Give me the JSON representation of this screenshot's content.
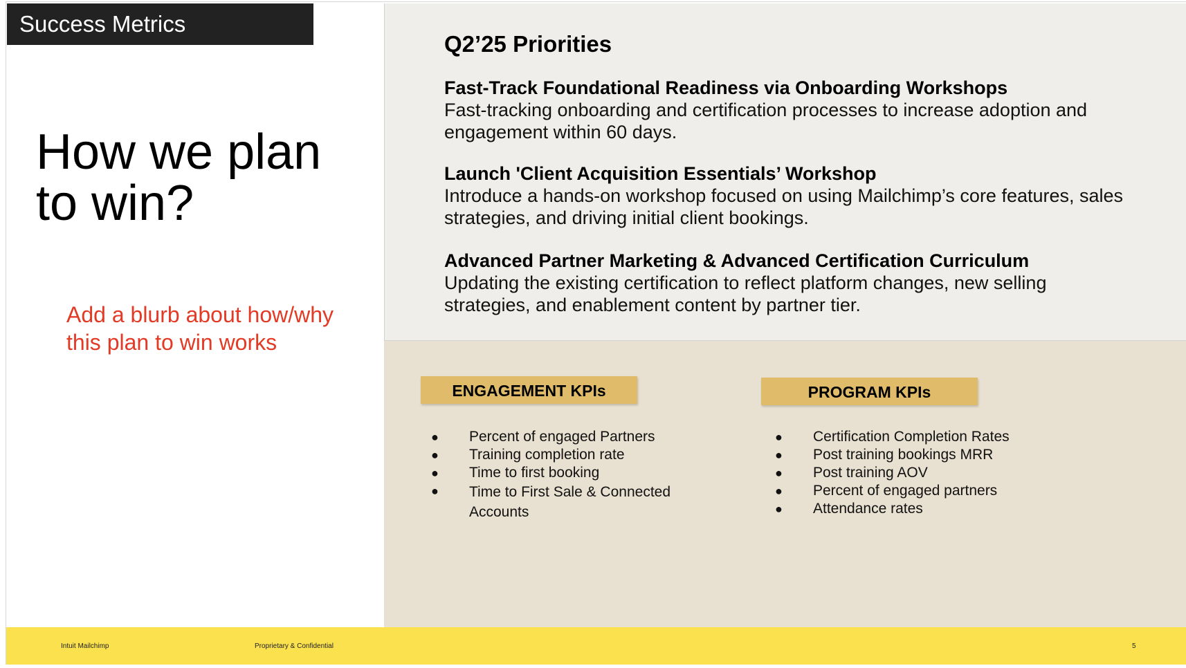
{
  "section_tag": "Success Metrics",
  "headline": "How we plan to win?",
  "blurb": "Add a blurb about how/why this plan to win works",
  "priorities": {
    "title": "Q2’25 Priorities",
    "items": [
      {
        "heading": "Fast-Track Foundational Readiness via Onboarding Workshops",
        "body": "Fast-tracking onboarding and certification processes to increase adoption and engagement within 60 days."
      },
      {
        "heading": "Launch 'Client Acquisition Essentials’ Workshop",
        "body": "Introduce a hands-on workshop focused on using Mailchimp’s core features, sales strategies, and driving initial client bookings."
      },
      {
        "heading": "Advanced Partner Marketing & Advanced Certification Curriculum",
        "body": "Updating the existing certification to reflect platform changes, new selling strategies, and enablement content by partner tier."
      }
    ]
  },
  "kpis": {
    "engagement": {
      "title": "ENGAGEMENT KPIs",
      "items": [
        "Percent of engaged Partners",
        "Training completion rate",
        "Time to first booking",
        "Time to First Sale & Connected Accounts"
      ]
    },
    "program": {
      "title": "PROGRAM KPIs",
      "items": [
        "Certification Completion Rates",
        "Post training bookings MRR",
        "Post training AOV",
        "Percent of engaged partners",
        "Attendance rates"
      ]
    }
  },
  "footer": {
    "brand": "Intuit Mailchimp",
    "confidential": "Proprietary & Confidential",
    "page_number": "5"
  },
  "colors": {
    "accent_yellow": "#fbe14d",
    "badge_gold": "#e0bb6a",
    "blurb_red": "#e23a25"
  }
}
